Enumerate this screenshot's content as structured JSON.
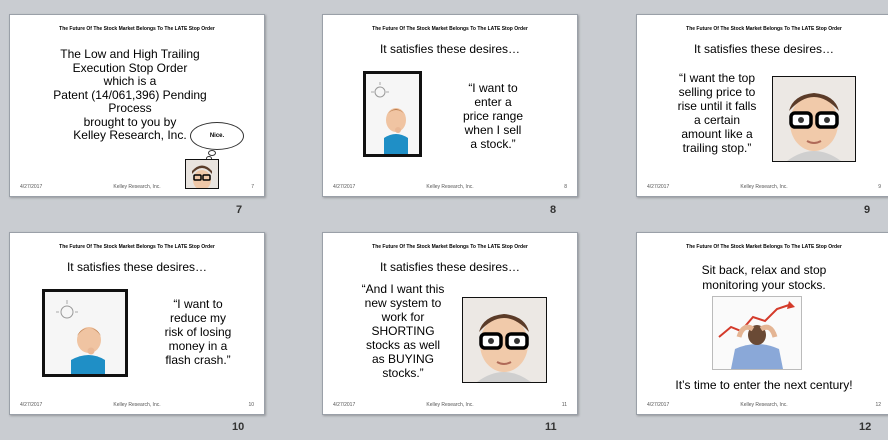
{
  "header_text": "The Future Of The Stock Market Belongs To The LATE Stop Order",
  "footer": {
    "date": "4/27/2017",
    "company": "Kelley Research, Inc."
  },
  "slides": [
    {
      "number": "7",
      "body_lines": [
        "The Low and High Trailing",
        "Execution Stop Order",
        "which is a",
        "Patent (14/061,396) Pending",
        "Process",
        "brought to you  by",
        "Kelley Research, Inc."
      ],
      "bubble": "Nice."
    },
    {
      "number": "8",
      "title": "It satisfies these desires…",
      "body_lines": [
        "“I want to",
        "enter a",
        "price range",
        "when I  sell",
        "a stock.”"
      ]
    },
    {
      "number": "9",
      "title": "It satisfies these desires…",
      "body_lines": [
        "“I want the top",
        "selling price to",
        "rise until it falls",
        "a certain",
        "amount like a",
        "trailing stop.”"
      ]
    },
    {
      "number": "10",
      "title": "It satisfies these desires…",
      "body_lines": [
        "“I want to",
        "reduce my",
        "risk of losing",
        "money in a",
        "flash crash.”"
      ]
    },
    {
      "number": "11",
      "title": "It satisfies these desires…",
      "body_lines": [
        "“And I want this",
        "new system to",
        "work for",
        "SHORTING",
        "stocks as well",
        "as BUYING",
        "stocks.”"
      ]
    },
    {
      "number": "12",
      "title_lines": [
        "Sit back, relax and stop",
        "monitoring your stocks."
      ],
      "closing": "It’s time to  enter the next century!"
    }
  ],
  "icons": {
    "thinking_child": "thinking-child-photo",
    "boy_glasses": "boy-glasses-photo",
    "relaxing_man": "relaxing-man-chart-photo",
    "lightbulb": "lightbulb-icon"
  }
}
